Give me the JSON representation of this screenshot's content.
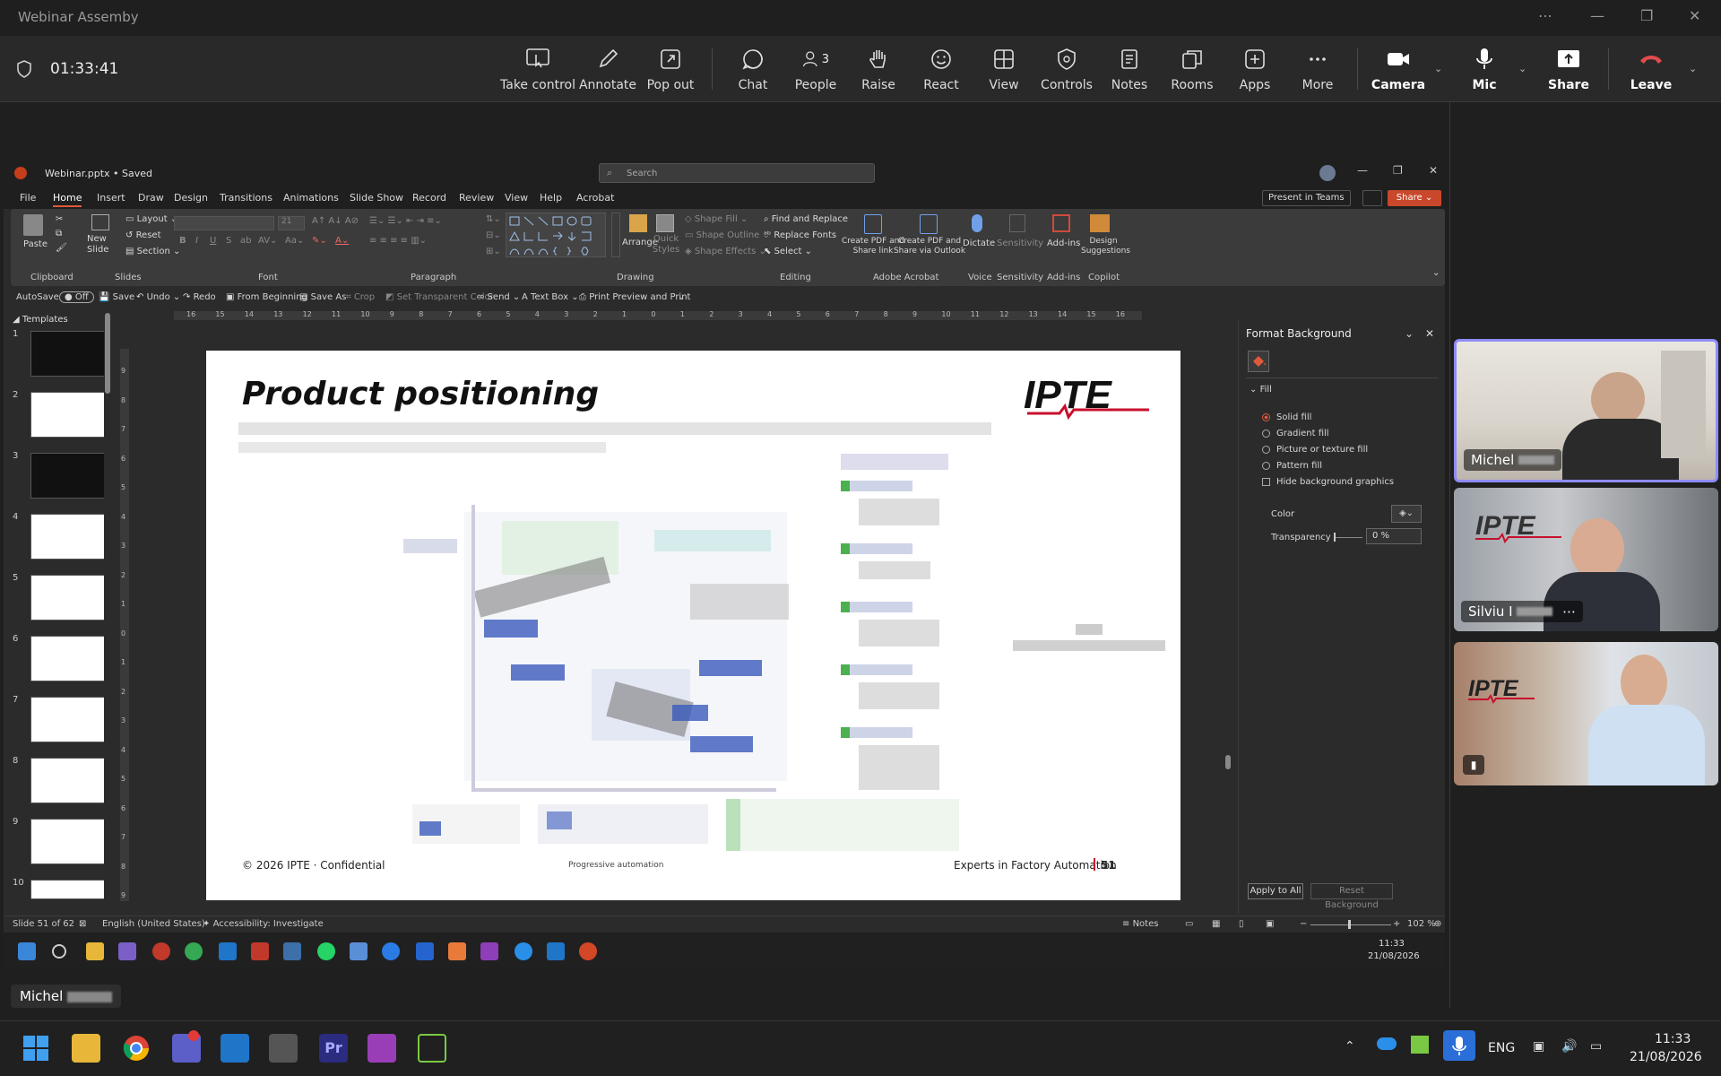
{
  "window": {
    "title": "Webinar Assemby"
  },
  "meeting": {
    "timer": "01:33:41",
    "tools": [
      {
        "label": "Take control",
        "icon": "take-control-icon"
      },
      {
        "label": "Annotate",
        "icon": "pen-icon"
      },
      {
        "label": "Pop out",
        "icon": "pop-out-icon"
      },
      {
        "label": "Chat",
        "icon": "chat-icon"
      },
      {
        "label": "People",
        "icon": "people-icon",
        "count": "3"
      },
      {
        "label": "Raise",
        "icon": "hand-icon"
      },
      {
        "label": "React",
        "icon": "smiley-icon"
      },
      {
        "label": "View",
        "icon": "grid-icon"
      },
      {
        "label": "Controls",
        "icon": "shield-gear-icon"
      },
      {
        "label": "Notes",
        "icon": "notes-icon"
      },
      {
        "label": "Rooms",
        "icon": "rooms-icon"
      },
      {
        "label": "Apps",
        "icon": "plus-icon"
      },
      {
        "label": "More",
        "icon": "more-icon"
      },
      {
        "label": "Camera",
        "icon": "camera-icon"
      },
      {
        "label": "Mic",
        "icon": "mic-icon"
      },
      {
        "label": "Share",
        "icon": "share-icon"
      },
      {
        "label": "Leave",
        "icon": "phone-hangup-icon"
      }
    ]
  },
  "ppt": {
    "filename": "Webinar.pptx • Saved",
    "search_placeholder": "Search",
    "tabs": [
      "File",
      "Home",
      "Insert",
      "Draw",
      "Design",
      "Transitions",
      "Animations",
      "Slide Show",
      "Record",
      "Review",
      "View",
      "Help",
      "Acrobat"
    ],
    "present_in_teams": "Present in Teams",
    "share": "Share",
    "ribbon": {
      "paste": "Paste",
      "clipboard": "Clipboard",
      "new_slide": "New Slide",
      "layout": "Layout",
      "reset": "Reset",
      "section": "Section",
      "slides": "Slides",
      "font_size": "21",
      "font": "Font",
      "paragraph": "Paragraph",
      "arrange": "Arrange",
      "quick_styles": "Quick Styles",
      "shape_fill": "Shape Fill",
      "shape_outline": "Shape Outline",
      "shape_effects": "Shape Effects",
      "drawing": "Drawing",
      "find_replace": "Find and Replace",
      "replace_fonts": "Replace Fonts",
      "select": "Select",
      "editing": "Editing",
      "create_pdf_link": "Create PDF and Share link",
      "create_pdf_outlook": "Create PDF and Share via Outlook",
      "adobe": "Adobe Acrobat",
      "dictate": "Dictate",
      "voice": "Voice",
      "sensitivity": "Sensitivity",
      "sensitivity_group": "Sensitivity",
      "addins": "Add-ins",
      "addins_group": "Add-ins",
      "design_suggestions": "Design Suggestions",
      "copilot": "Copilot"
    },
    "qat": [
      "AutoSave",
      "Off",
      "Save",
      "Undo",
      "Redo",
      "From Beginning",
      "Save As",
      "Crop",
      "Set Transparent Color",
      "Send",
      "Text Box",
      "Print Preview and Print"
    ],
    "section": "Templates",
    "thumb_numbers": [
      "1",
      "2",
      "3",
      "4",
      "5",
      "6",
      "7",
      "8",
      "9",
      "10"
    ],
    "ruler_top": [
      "16",
      "15",
      "14",
      "13",
      "12",
      "11",
      "10",
      "9",
      "8",
      "7",
      "6",
      "5",
      "4",
      "3",
      "2",
      "1",
      "0",
      "1",
      "2",
      "3",
      "4",
      "5",
      "6",
      "7",
      "8",
      "9",
      "10",
      "11",
      "12",
      "13",
      "14",
      "15",
      "16"
    ],
    "ruler_left": [
      "9",
      "8",
      "7",
      "6",
      "5",
      "4",
      "3",
      "2",
      "1",
      "0",
      "1",
      "2",
      "3",
      "4",
      "5",
      "6",
      "7",
      "8",
      "9"
    ],
    "slide": {
      "title": "Product positioning",
      "logo": "IPTE",
      "footer_left": "© 2026 IPTE · Confidential",
      "footer_mid": "Progressive automation",
      "footer_right": "Experts in Factory Automation",
      "page": "51"
    },
    "format_bg": {
      "title": "Format Background",
      "fill": "Fill",
      "options": [
        "Solid fill",
        "Gradient fill",
        "Picture or texture fill",
        "Pattern fill"
      ],
      "hide_bg": "Hide background graphics",
      "color": "Color",
      "transparency": "Transparency",
      "transparency_value": "0 %",
      "apply_all": "Apply to All",
      "reset_bg": "Reset Background"
    },
    "status": {
      "slide": "Slide 51 of 62",
      "language": "English (United States)",
      "accessibility": "Accessibility: Investigate",
      "notes": "Notes",
      "zoom": "102 %"
    }
  },
  "inner_taskbar": {
    "time": "11:33",
    "date": "21/08/2026"
  },
  "presenter_label": "Michel",
  "participants": [
    {
      "name": "Michel"
    },
    {
      "name": "Silviu I"
    },
    {
      "name": ""
    }
  ],
  "os_taskbar": {
    "lang": "ENG",
    "time": "11:33",
    "date": "21/08/2026"
  }
}
